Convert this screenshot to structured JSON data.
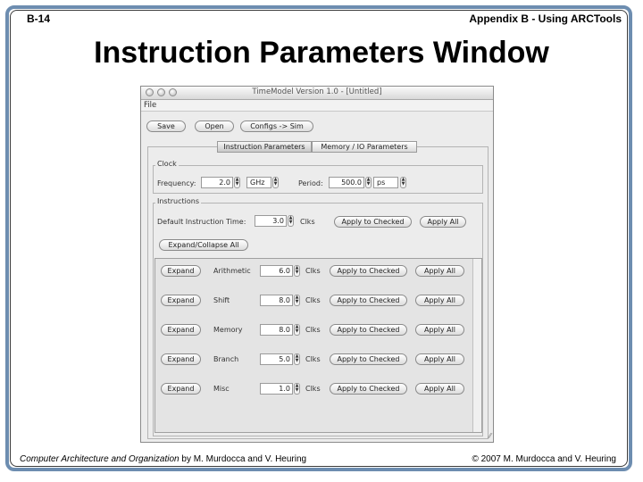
{
  "slide": {
    "number": "B-14",
    "section": "Appendix B - Using ARCTools",
    "title": "Instruction Parameters Window",
    "footer_book": "Computer Architecture and Organization",
    "footer_authors": " by M. Murdocca and V. Heuring",
    "footer_copyright": "© 2007 M. Murdocca and V. Heuring"
  },
  "window": {
    "title": "TimeModel Version 1.0 - [Untitled]",
    "menu": [
      "File"
    ],
    "toolbar": {
      "save": "Save",
      "open": "Open",
      "configs": "Configs -> Sim"
    },
    "tabs": [
      {
        "label": "Instruction Parameters",
        "active": true
      },
      {
        "label": "Memory / IO Parameters",
        "active": false
      }
    ],
    "clock": {
      "legend": "Clock",
      "frequency_label": "Frequency:",
      "frequency_value": "2.0",
      "frequency_unit": "GHz",
      "period_label": "Period:",
      "period_value": "500.0",
      "period_unit": "ps"
    },
    "instructions": {
      "legend": "Instructions",
      "default_label": "Default Instruction Time:",
      "default_value": "3.0",
      "default_unit": "Clks",
      "apply_checked": "Apply to Checked",
      "apply_all": "Apply All",
      "expand_collapse_all": "Expand/Collapse All",
      "rows": [
        {
          "expand": "Expand",
          "name": "Arithmetic",
          "value": "6.0",
          "unit": "Clks",
          "apply_checked": "Apply to Checked",
          "apply_all": "Apply All"
        },
        {
          "expand": "Expand",
          "name": "Shift",
          "value": "8.0",
          "unit": "Clks",
          "apply_checked": "Apply to Checked",
          "apply_all": "Apply All"
        },
        {
          "expand": "Expand",
          "name": "Memory",
          "value": "8.0",
          "unit": "Clks",
          "apply_checked": "Apply to Checked",
          "apply_all": "Apply All"
        },
        {
          "expand": "Expand",
          "name": "Branch",
          "value": "5.0",
          "unit": "Clks",
          "apply_checked": "Apply to Checked",
          "apply_all": "Apply All"
        },
        {
          "expand": "Expand",
          "name": "Misc",
          "value": "1.0",
          "unit": "Clks",
          "apply_checked": "Apply to Checked",
          "apply_all": "Apply All"
        }
      ]
    }
  }
}
